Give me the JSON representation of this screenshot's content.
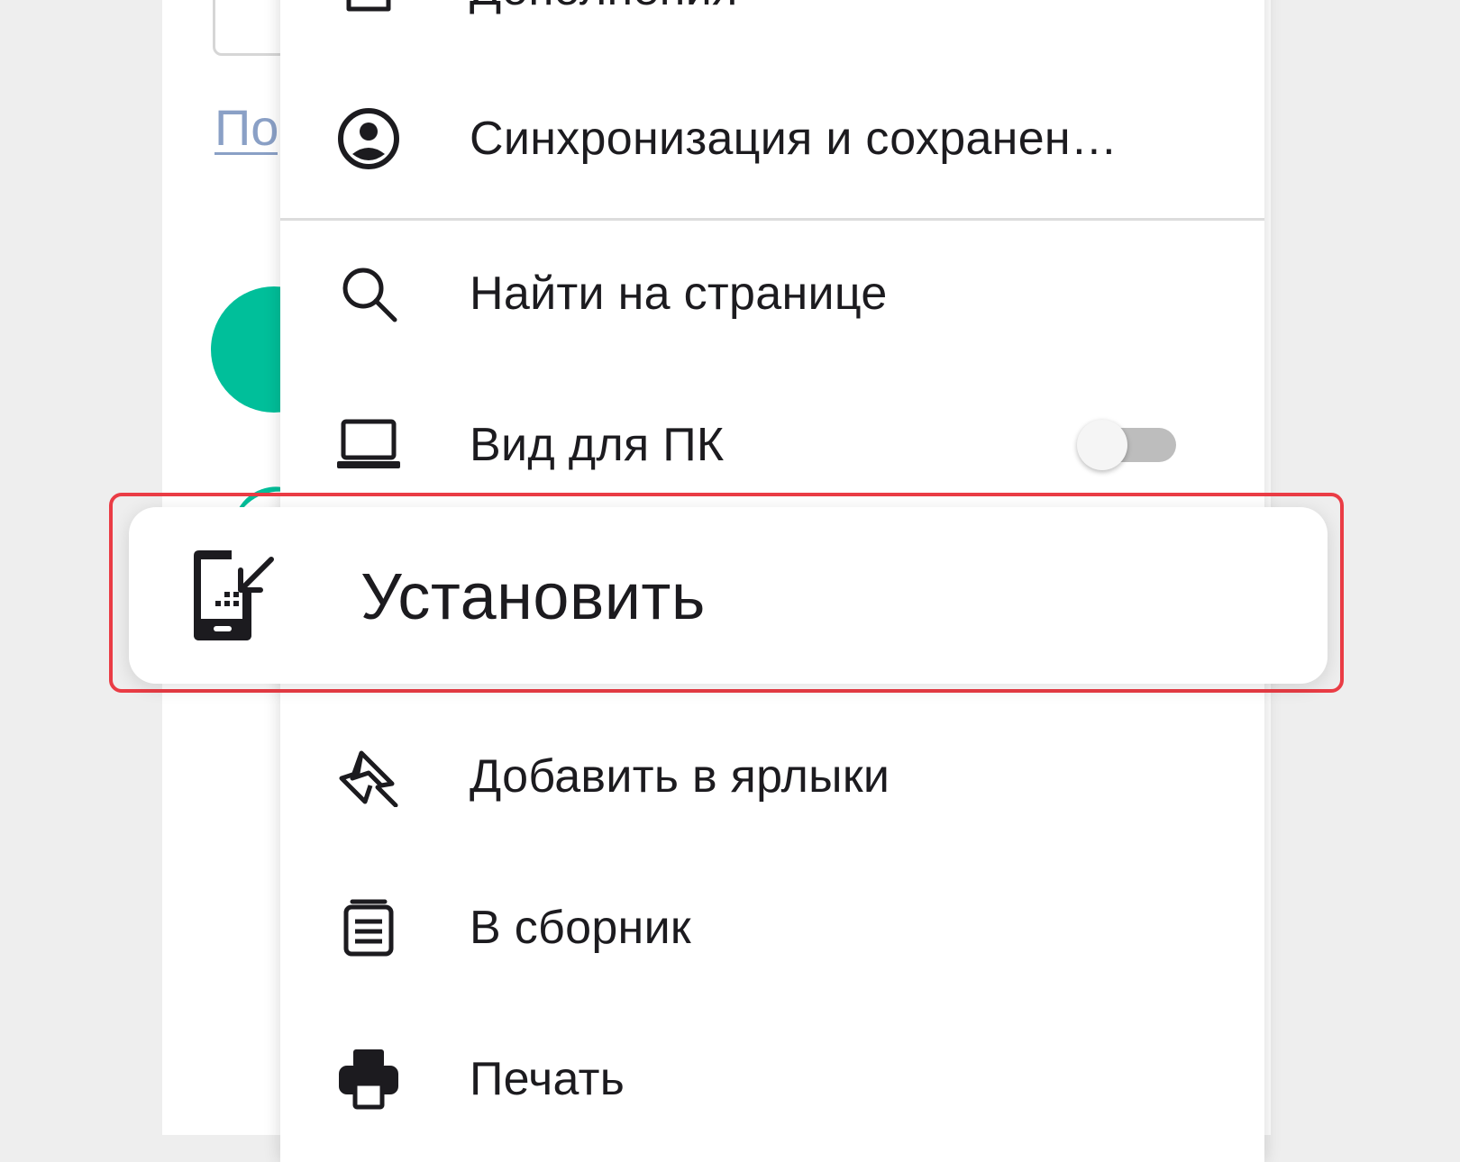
{
  "background": {
    "link_text": "По"
  },
  "menu": {
    "items": [
      {
        "name": "addons",
        "label": "Дополнения",
        "icon": "puzzle-icon"
      },
      {
        "name": "sync",
        "label": "Синхронизация и сохранен…",
        "icon": "account-circle-icon"
      },
      {
        "name": "find-in-page",
        "label": "Найти на странице",
        "icon": "search-icon"
      },
      {
        "name": "desktop-view",
        "label": "Вид для ПК",
        "icon": "laptop-icon",
        "toggle_on": false
      },
      {
        "name": "add-shortcut",
        "label": "Добавить в ярлыки",
        "icon": "pin-icon"
      },
      {
        "name": "collection",
        "label": "В сборник",
        "icon": "collection-icon"
      },
      {
        "name": "print",
        "label": "Печать",
        "icon": "printer-icon"
      }
    ],
    "install": {
      "label": "Установить",
      "icon": "install-app-icon"
    }
  },
  "colors": {
    "highlight_border": "#ea3c45",
    "accent_green": "#00bf9a",
    "link": "#8aa0c6"
  }
}
